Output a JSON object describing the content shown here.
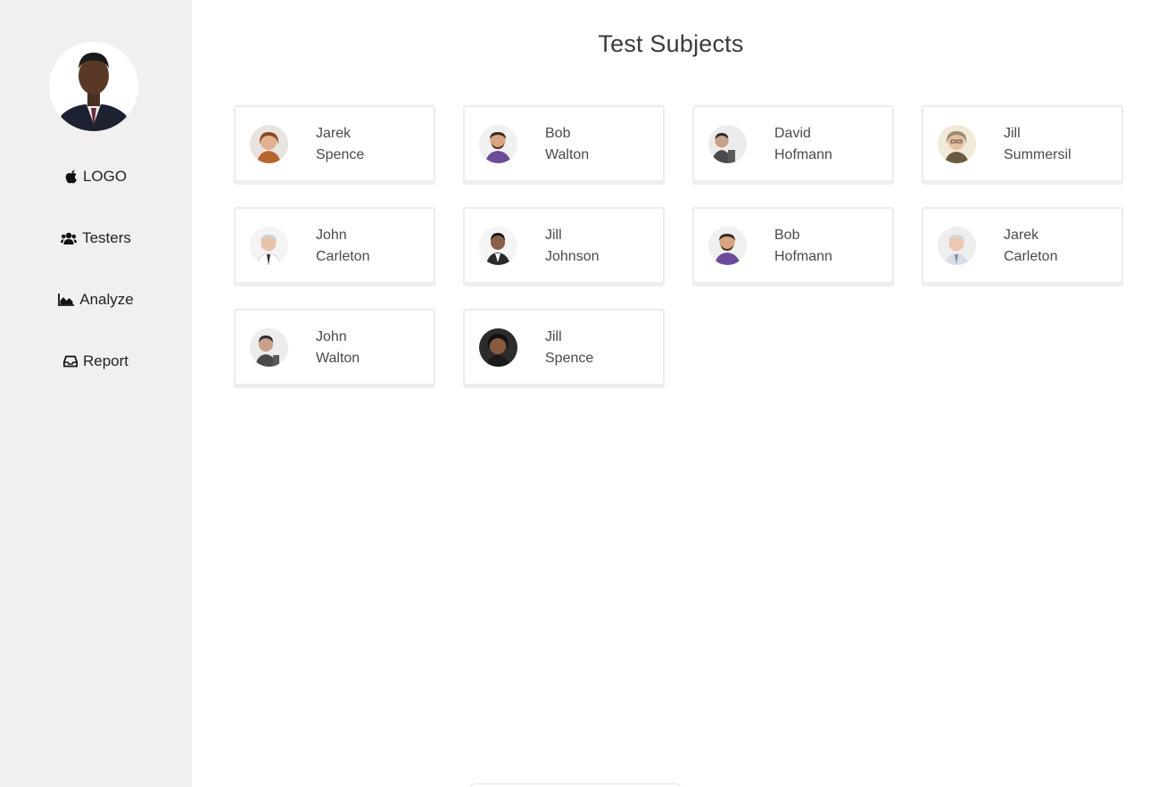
{
  "sidebar": {
    "avatar_icon": "user-portrait",
    "nav": [
      {
        "label": "LOGO",
        "icon": "apple-icon"
      },
      {
        "label": "Testers",
        "icon": "users-icon"
      },
      {
        "label": "Analyze",
        "icon": "area-chart-icon"
      },
      {
        "label": "Report",
        "icon": "inbox-icon"
      }
    ]
  },
  "main": {
    "title": "Test Subjects",
    "subjects": [
      {
        "first": "Jarek",
        "last": "Spence"
      },
      {
        "first": "Bob",
        "last": "Walton"
      },
      {
        "first": "David",
        "last": "Hofmann"
      },
      {
        "first": "Jill",
        "last": "Summersil"
      },
      {
        "first": "John",
        "last": "Carleton"
      },
      {
        "first": "Jill",
        "last": "Johnson"
      },
      {
        "first": "Bob",
        "last": "Hofmann"
      },
      {
        "first": "Jarek",
        "last": "Carleton"
      },
      {
        "first": "John",
        "last": "Walton"
      },
      {
        "first": "Jill",
        "last": "Spence"
      }
    ]
  },
  "colors": {
    "sidebar_bg": "#f0f0f0",
    "card_border": "#ececec",
    "text": "#4a4a4a"
  }
}
